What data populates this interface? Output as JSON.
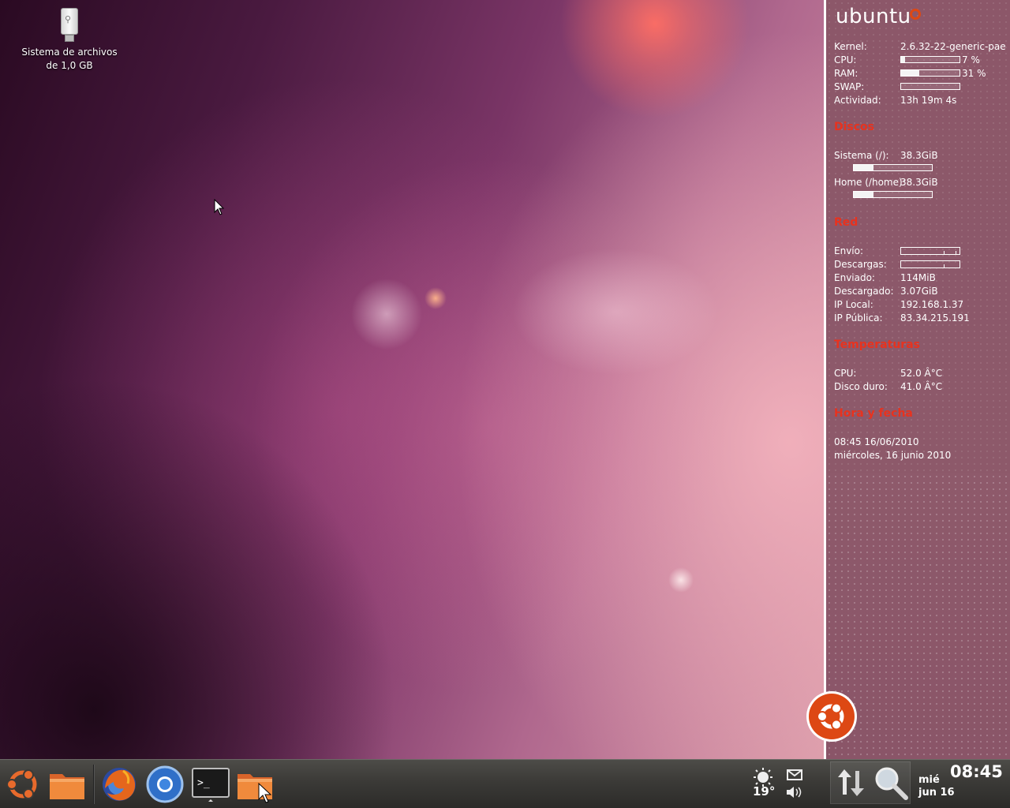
{
  "desktop": {
    "icons": [
      {
        "label": "Sistema de archivos\nde 1,0 GB",
        "icon": "usb-drive-icon"
      }
    ]
  },
  "conky": {
    "logo": "ubuntu",
    "system": {
      "kernel_label": "Kernel:",
      "kernel_value": "2.6.32-22-generic-pae",
      "cpu_label": "CPU:",
      "cpu_value": "7 %",
      "cpu_fraction": 0.07,
      "ram_label": "RAM:",
      "ram_value": "31 %",
      "ram_fraction": 0.31,
      "swap_label": "SWAP:",
      "swap_fraction": 0.0,
      "uptime_label": "Actividad:",
      "uptime_value": "13h 19m 4s"
    },
    "disks": {
      "title": "Discos",
      "root_label": "Sistema (/):",
      "root_value": "38.3GiB",
      "root_fraction": 0.25,
      "home_label": "Home (/home):",
      "home_value": "38.3GiB",
      "home_fraction": 0.25
    },
    "network": {
      "title": "Red",
      "upload_label": "Envío:",
      "download_label": "Descargas:",
      "sent_label": "Enviado:",
      "sent_value": "114MiB",
      "received_label": "Descargado:",
      "received_value": "3.07GiB",
      "local_ip_label": "IP Local:",
      "local_ip_value": "192.168.1.37",
      "public_ip_label": "IP Pública:",
      "public_ip_value": "83.34.215.191"
    },
    "temperatures": {
      "title": "Temperaturas",
      "cpu_label": "CPU:",
      "cpu_value": "52.0 Â°C",
      "disk_label": "Disco duro:",
      "disk_value": "41.0 Â°C"
    },
    "datetime": {
      "title": "Hora y fecha",
      "line1": "08:45  16/06/2010",
      "line2": "miércoles, 16 junio 2010"
    }
  },
  "panel": {
    "launchers": [
      {
        "name": "ubuntu-menu-icon"
      },
      {
        "name": "home-folder-icon"
      },
      {
        "name": "firefox-icon"
      },
      {
        "name": "chromium-icon"
      },
      {
        "name": "terminal-icon"
      },
      {
        "name": "folder-icon"
      }
    ],
    "weather_temp": "19°",
    "clock": {
      "time": "08:45",
      "day": "mié",
      "date": "jun 16"
    }
  },
  "colors": {
    "accent": "#dd4814",
    "heading": "#e8321e",
    "panel": "#3b3a37"
  }
}
